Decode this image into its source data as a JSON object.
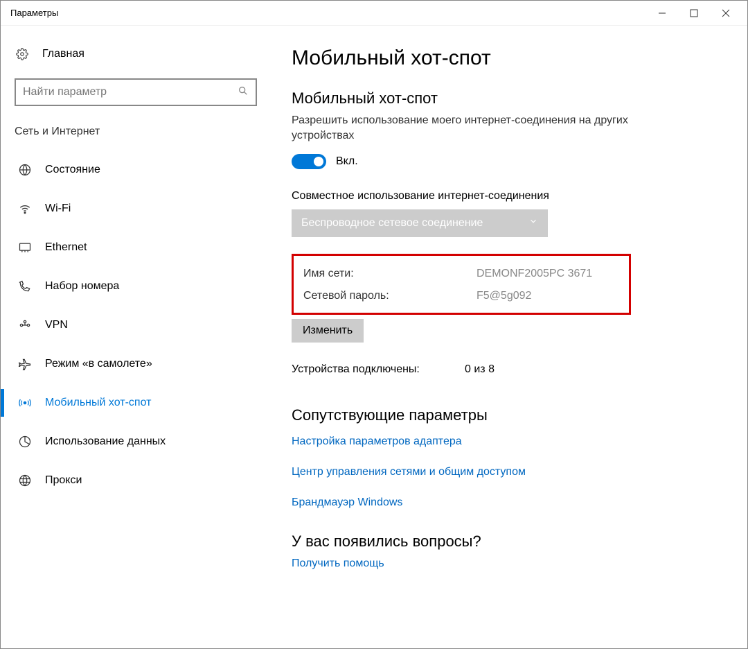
{
  "window": {
    "title": "Параметры"
  },
  "sidebar": {
    "home": "Главная",
    "search_placeholder": "Найти параметр",
    "category": "Сеть и Интернет",
    "items": [
      {
        "label": "Состояние"
      },
      {
        "label": "Wi-Fi"
      },
      {
        "label": "Ethernet"
      },
      {
        "label": "Набор номера"
      },
      {
        "label": "VPN"
      },
      {
        "label": "Режим «в самолете»"
      },
      {
        "label": "Мобильный хот-спот"
      },
      {
        "label": "Использование данных"
      },
      {
        "label": "Прокси"
      }
    ]
  },
  "main": {
    "title": "Мобильный хот-спот",
    "subsection": "Мобильный хот-спот",
    "desc": "Разрешить использование моего интернет-соединения на других устройствах",
    "toggle_state": "Вкл.",
    "share_label": "Совместное использование интернет-соединения",
    "dropdown_value": "Беспроводное сетевое соединение",
    "network_name_label": "Имя сети:",
    "network_name_value": "DEMONF2005PC 3671",
    "network_pass_label": "Сетевой пароль:",
    "network_pass_value": "F5@5g092",
    "change_btn": "Изменить",
    "devices_label": "Устройства подключены:",
    "devices_value": "0 из 8",
    "related_title": "Сопутствующие параметры",
    "links": [
      "Настройка параметров адаптера",
      "Центр управления сетями и общим доступом",
      "Брандмауэр Windows"
    ],
    "questions_title": "У вас появились вопросы?",
    "help_link": "Получить помощь"
  }
}
